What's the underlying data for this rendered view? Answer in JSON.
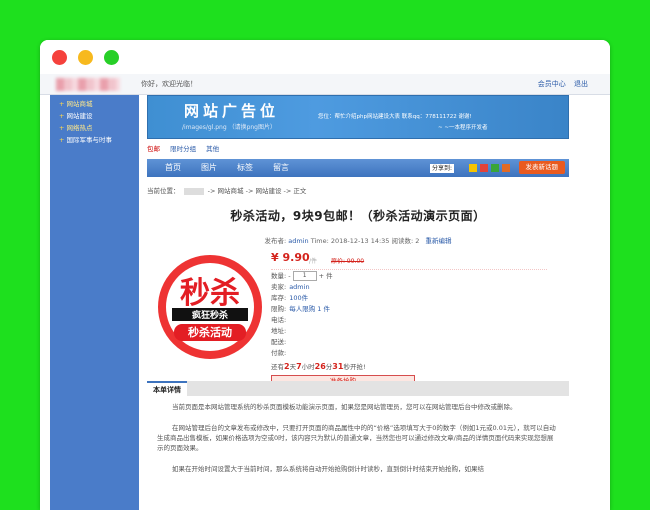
{
  "window": {
    "controls": [
      "close",
      "minimize",
      "maximize"
    ]
  },
  "topbar": {
    "greeting": "你好，欢迎光临！",
    "links": [
      "会员中心",
      "退出"
    ]
  },
  "sidebar": {
    "items": [
      {
        "label": "网站商城",
        "style": "first"
      },
      {
        "label": "网站建设",
        "style": "normal"
      },
      {
        "label": "网络热点",
        "style": "hot"
      },
      {
        "label": "国际军事与时事",
        "style": "normal"
      }
    ]
  },
  "banner": {
    "title": "网站广告位",
    "sub": "/images/gl.png （请换png图片）",
    "right": "您位：帮忙介绍php网站建设大表   联系qq：778111722  谢谢!",
    "right2": "~ ~一本程序开发者"
  },
  "subnav": {
    "items": [
      "包邮",
      "限时分组",
      "其他"
    ]
  },
  "menu": {
    "items": [
      "首页",
      "图片",
      "标签",
      "留言"
    ],
    "share": "分享到:",
    "release": "发表新话题"
  },
  "crumb": {
    "label": "当前位置：",
    "parts": [
      "-> 网站商城",
      "-> 网站建设",
      "-> 正文"
    ]
  },
  "article": {
    "title": "秒杀活动，9块9包邮！（秒杀活动演示页面）",
    "author_label": "发布者:",
    "author": "admin",
    "time": "Time: 2018-12-13 14:35",
    "reads": "阅读数: 2",
    "edit": "重新编辑"
  },
  "product": {
    "image_text": {
      "top": "秒杀",
      "band": "疯狂秒杀",
      "bottom": "秒杀活动"
    },
    "price": "¥ 9.90",
    "price_unit": "/件",
    "orig": "原价: 99.00",
    "qty_label": "数量:",
    "qty": "1",
    "qty_unit": "件",
    "seller_label": "卖家:",
    "seller": "admin",
    "stock_label": "库存:",
    "stock": "100件",
    "limit_label": "限购:",
    "limit": "每人限购 1 件",
    "phone_label": "电话:",
    "address_label": "地址:",
    "shipping_label": "配送:",
    "payment_label": "付款:",
    "countdown": {
      "pre": "还有",
      "days": "2",
      "d": "天",
      "hours": "7",
      "h": "小时",
      "mins": "26",
      "m": "分",
      "secs": "31",
      "s": "秒开抢!"
    },
    "buy": "准备抢购"
  },
  "tabs": {
    "detail": "本单详情"
  },
  "content": {
    "paragraphs": [
      "当前页面是本网站管理系统的秒杀页面模板功能演示页面，如果您是网站管理员，您可以在网站管理后台中修改或删除。",
      "在网站管理后台的文章发布或修改中，只要打开页面的商品属性中的的“价格”选项填写大于0的数字（例如1元或0.01元），就可以自动生成商品出售模板，如果价格选项为空或0时，该内容只为默认的普通文章，当然您也可以通过修改文章/商品的详情页面代码来实现您想展示的页面效果。",
      "如果在开始时间设置大于当前时间，那么系统将自动开始抢购倒计时读秒，直到倒计时结束开始抢购，如果结"
    ]
  }
}
